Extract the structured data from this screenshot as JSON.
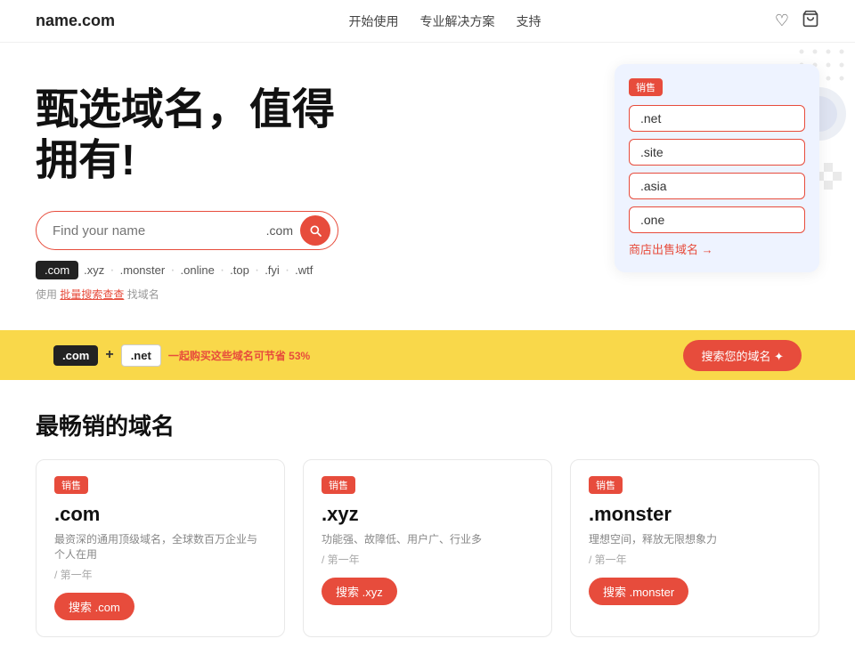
{
  "header": {
    "logo": "name.com",
    "nav": [
      {
        "label": "开始使用",
        "key": "get-started"
      },
      {
        "label": "专业解决方案",
        "key": "professional"
      },
      {
        "label": "支持",
        "key": "support"
      }
    ],
    "icon_heart": "♡",
    "icon_cart": "🛒"
  },
  "hero": {
    "title_line1": "甄选域名，值得",
    "title_line2": "拥有!",
    "search_placeholder": "Find your name",
    "search_suffix": ".com",
    "tags": [
      {
        "label": ".com",
        "active": true
      },
      {
        "label": ".xyz",
        "active": false
      },
      {
        "label": ".monster",
        "active": false
      },
      {
        "label": ".online",
        "active": false
      },
      {
        "label": ".top",
        "active": false
      },
      {
        "label": ".fyi",
        "active": false
      },
      {
        "label": ".wtf",
        "active": false
      }
    ],
    "bulk_text": "使用",
    "bulk_link": "批量搜索查查",
    "bulk_suffix": "找域名"
  },
  "card_panel": {
    "badge": "销售",
    "domains": [
      ".net",
      ".site",
      ".asia",
      ".one"
    ],
    "shop_link": "商店出售域名 →"
  },
  "promo_bar": {
    "tag1": ".com",
    "plus": "+",
    "tag2": ".net",
    "desc_prefix": "一起购买这些域名可节省",
    "discount": "53%",
    "btn_label": "搜索您的域名 ✦"
  },
  "bestselling": {
    "title": "最畅销的域名",
    "cards": [
      {
        "badge": "销售",
        "name": ".com",
        "desc": "最资深的通用顶级域名，全球数百万企业与个人在用",
        "year": "/ 第一年",
        "btn_label": "搜索 .com"
      },
      {
        "badge": "销售",
        "name": ".xyz",
        "desc": "功能强、故障低、用户广、行业多",
        "year": "/ 第一年",
        "btn_label": "搜索 .xyz"
      },
      {
        "badge": "销售",
        "name": ".monster",
        "desc": "理想空间，释放无限想象力",
        "year": "/ 第一年",
        "btn_label": "搜索 .monster"
      }
    ]
  },
  "colors": {
    "accent": "#e74c3c",
    "promo_bg": "#f9d84a",
    "card_bg": "#eef3ff"
  }
}
